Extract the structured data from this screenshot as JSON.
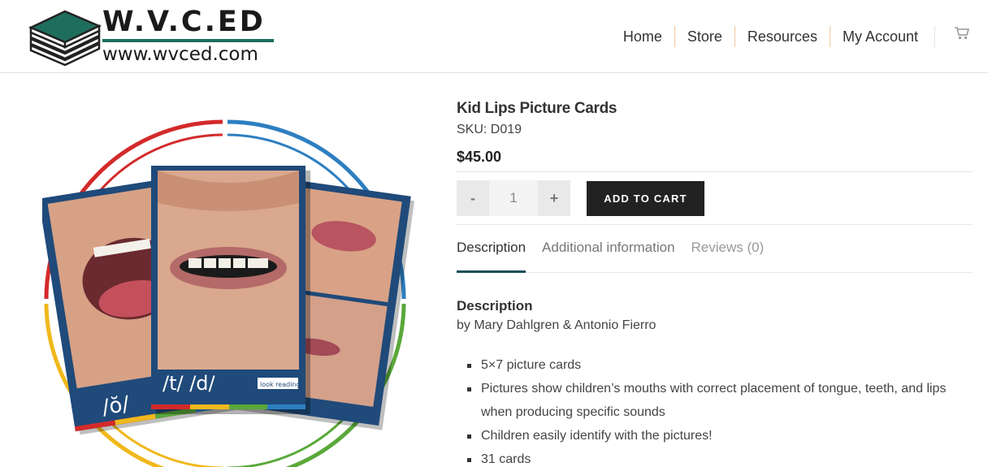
{
  "logo": {
    "title": "W.V.C.ED",
    "url": "www.wvced.com",
    "icon": "books-icon",
    "brand_color": "#1e6e5e"
  },
  "nav": {
    "items": [
      "Home",
      "Store",
      "Resources",
      "My Account"
    ],
    "cart_icon": "cart-icon"
  },
  "product": {
    "title": "Kid Lips Picture Cards",
    "sku": "SKU: D019",
    "price": "$45.00",
    "image_labels": {
      "left": "/ŏ/",
      "center": "/t/  /d/",
      "brand": "look reading"
    }
  },
  "cart": {
    "minus_label": "-",
    "quantity": "1",
    "plus_label": "+",
    "add_label": "ADD TO CART"
  },
  "tabs": [
    {
      "label": "Description",
      "active": true
    },
    {
      "label": "Additional information",
      "active": false
    },
    {
      "label": "Reviews (0)",
      "active": false
    }
  ],
  "description": {
    "heading": "Description",
    "byline": "by Mary Dahlgren & Antonio Fierro",
    "bullets": [
      "5×7 picture cards",
      "Pictures show children’s mouths with correct placement of tongue, teeth, and lips when producing specific sounds",
      "Children easily identify with the pictures!",
      "31 cards"
    ]
  },
  "colors": {
    "card_blue": "#1f4a7a",
    "ring_red": "#d42a2a",
    "ring_blue": "#2d7fc1",
    "ring_green": "#5aa83a",
    "ring_yellow": "#f0b81c"
  }
}
